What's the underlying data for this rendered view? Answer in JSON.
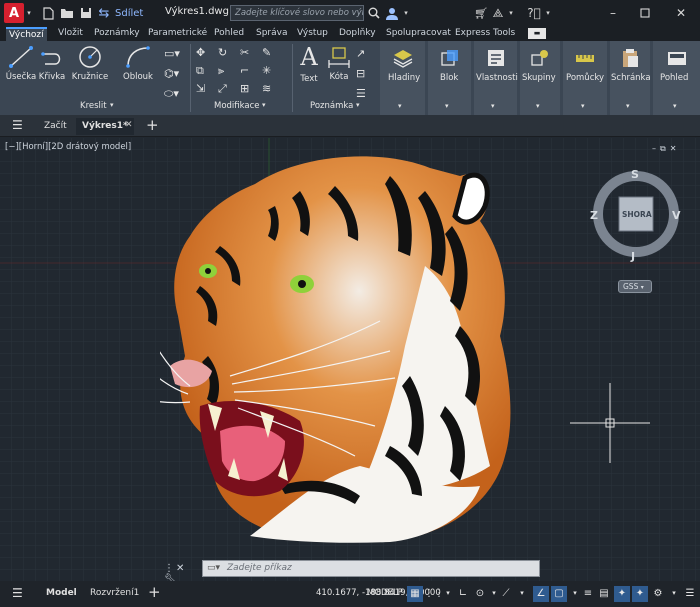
{
  "titlebar": {
    "logo_letter": "A",
    "share_label": "Sdílet",
    "document_title": "Výkres1.dwg",
    "search_placeholder": "Zadejte klíčové slovo nebo výraz."
  },
  "ribbon_tabs": [
    "Výchozí",
    "Vložit",
    "Poznámky",
    "Parametrické",
    "Pohled",
    "Správa",
    "Výstup",
    "Doplňky",
    "Spolupracovat",
    "Express Tools"
  ],
  "ribbon": {
    "draw": {
      "title": "Kreslit",
      "tools": [
        "Úsečka",
        "Křivka",
        "Kružnice",
        "Oblouk"
      ]
    },
    "modify": {
      "title": "Modifikace"
    },
    "annotation": {
      "title": "Poznámka",
      "tools": [
        "Text",
        "Kóta"
      ]
    },
    "big": [
      "Hladiny",
      "Blok",
      "Vlastnosti",
      "Skupiny",
      "Pomůcky",
      "Schránka",
      "Pohled"
    ]
  },
  "file_tabs": {
    "start": "Začít",
    "active": "Výkres1*"
  },
  "viewport": {
    "label": "[−][Horní][2D drátový model]"
  },
  "viewcube": {
    "top": "S",
    "bottom": "J",
    "left": "Z",
    "right": "V",
    "face": "SHORA",
    "ucs": "GSS"
  },
  "command": {
    "placeholder": "Zadejte příkaz"
  },
  "status": {
    "model_tab": "Model",
    "layout_tab": "Rozvržení1",
    "coords": "410.1677, -188.8419, 0.0000",
    "space": "MODELP"
  },
  "colors": {
    "accent": "#4b9eff",
    "canvas": "#212830",
    "ribbon": "#3b4653",
    "logo": "#d6202f"
  }
}
